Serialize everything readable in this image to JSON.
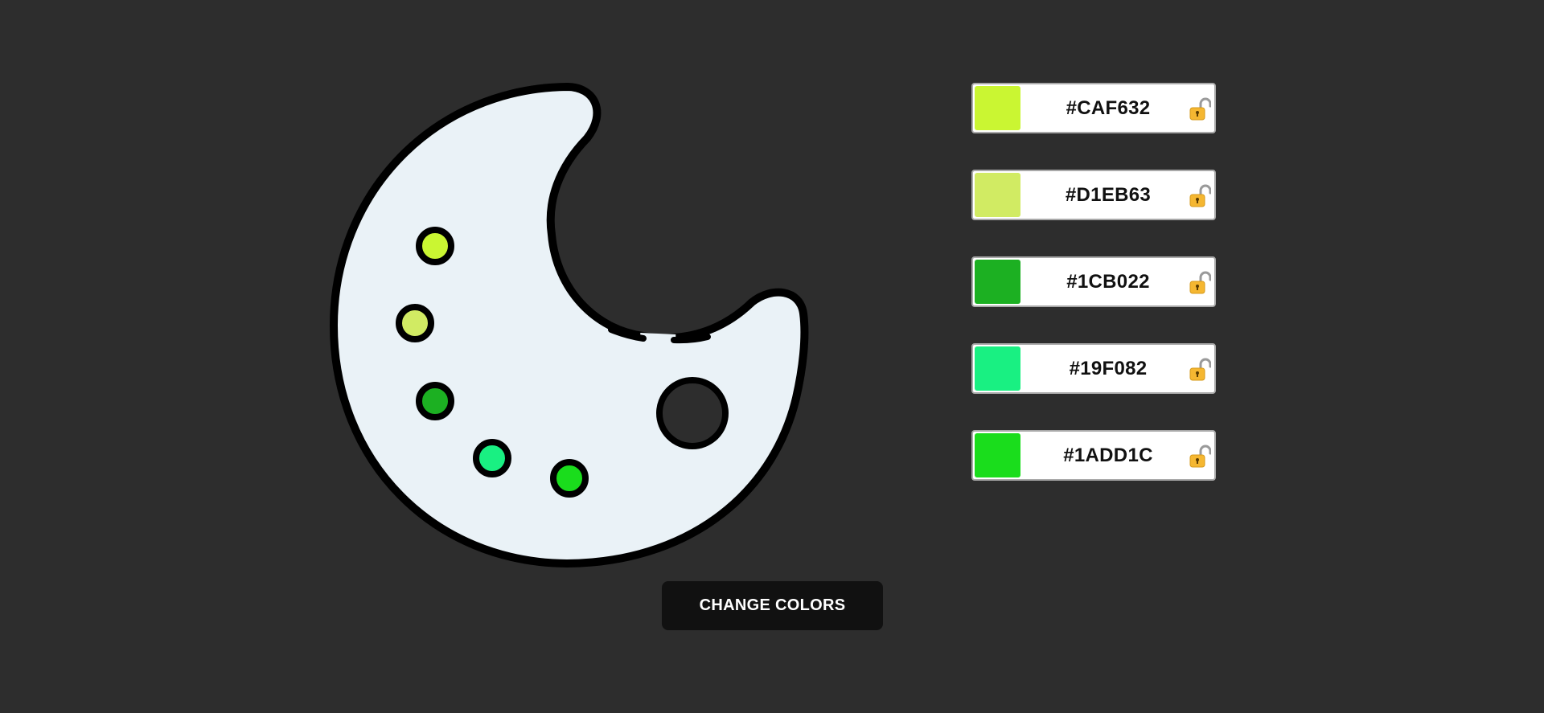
{
  "palette": {
    "background_color": "#EAF2F7",
    "outline_color": "#000000",
    "hole_color": "#2D2D2D",
    "dots": [
      {
        "color": "#CAF632"
      },
      {
        "color": "#D1EB63"
      },
      {
        "color": "#1CB022"
      },
      {
        "color": "#19F082"
      },
      {
        "color": "#1ADD1C"
      }
    ]
  },
  "swatches": [
    {
      "hex": "#CAF632",
      "color": "#CAF632",
      "locked": false,
      "icon": "lock-open-icon"
    },
    {
      "hex": "#D1EB63",
      "color": "#D1EB63",
      "locked": false,
      "icon": "lock-open-icon"
    },
    {
      "hex": "#1CB022",
      "color": "#1CB022",
      "locked": false,
      "icon": "lock-open-icon"
    },
    {
      "hex": "#19F082",
      "color": "#19F082",
      "locked": false,
      "icon": "lock-open-icon"
    },
    {
      "hex": "#1ADD1C",
      "color": "#1ADD1C",
      "locked": false,
      "icon": "lock-open-icon"
    }
  ],
  "change_button": {
    "label": "CHANGE COLORS"
  },
  "theme": {
    "page_background": "#2D2D2D",
    "button_background": "#111111"
  }
}
